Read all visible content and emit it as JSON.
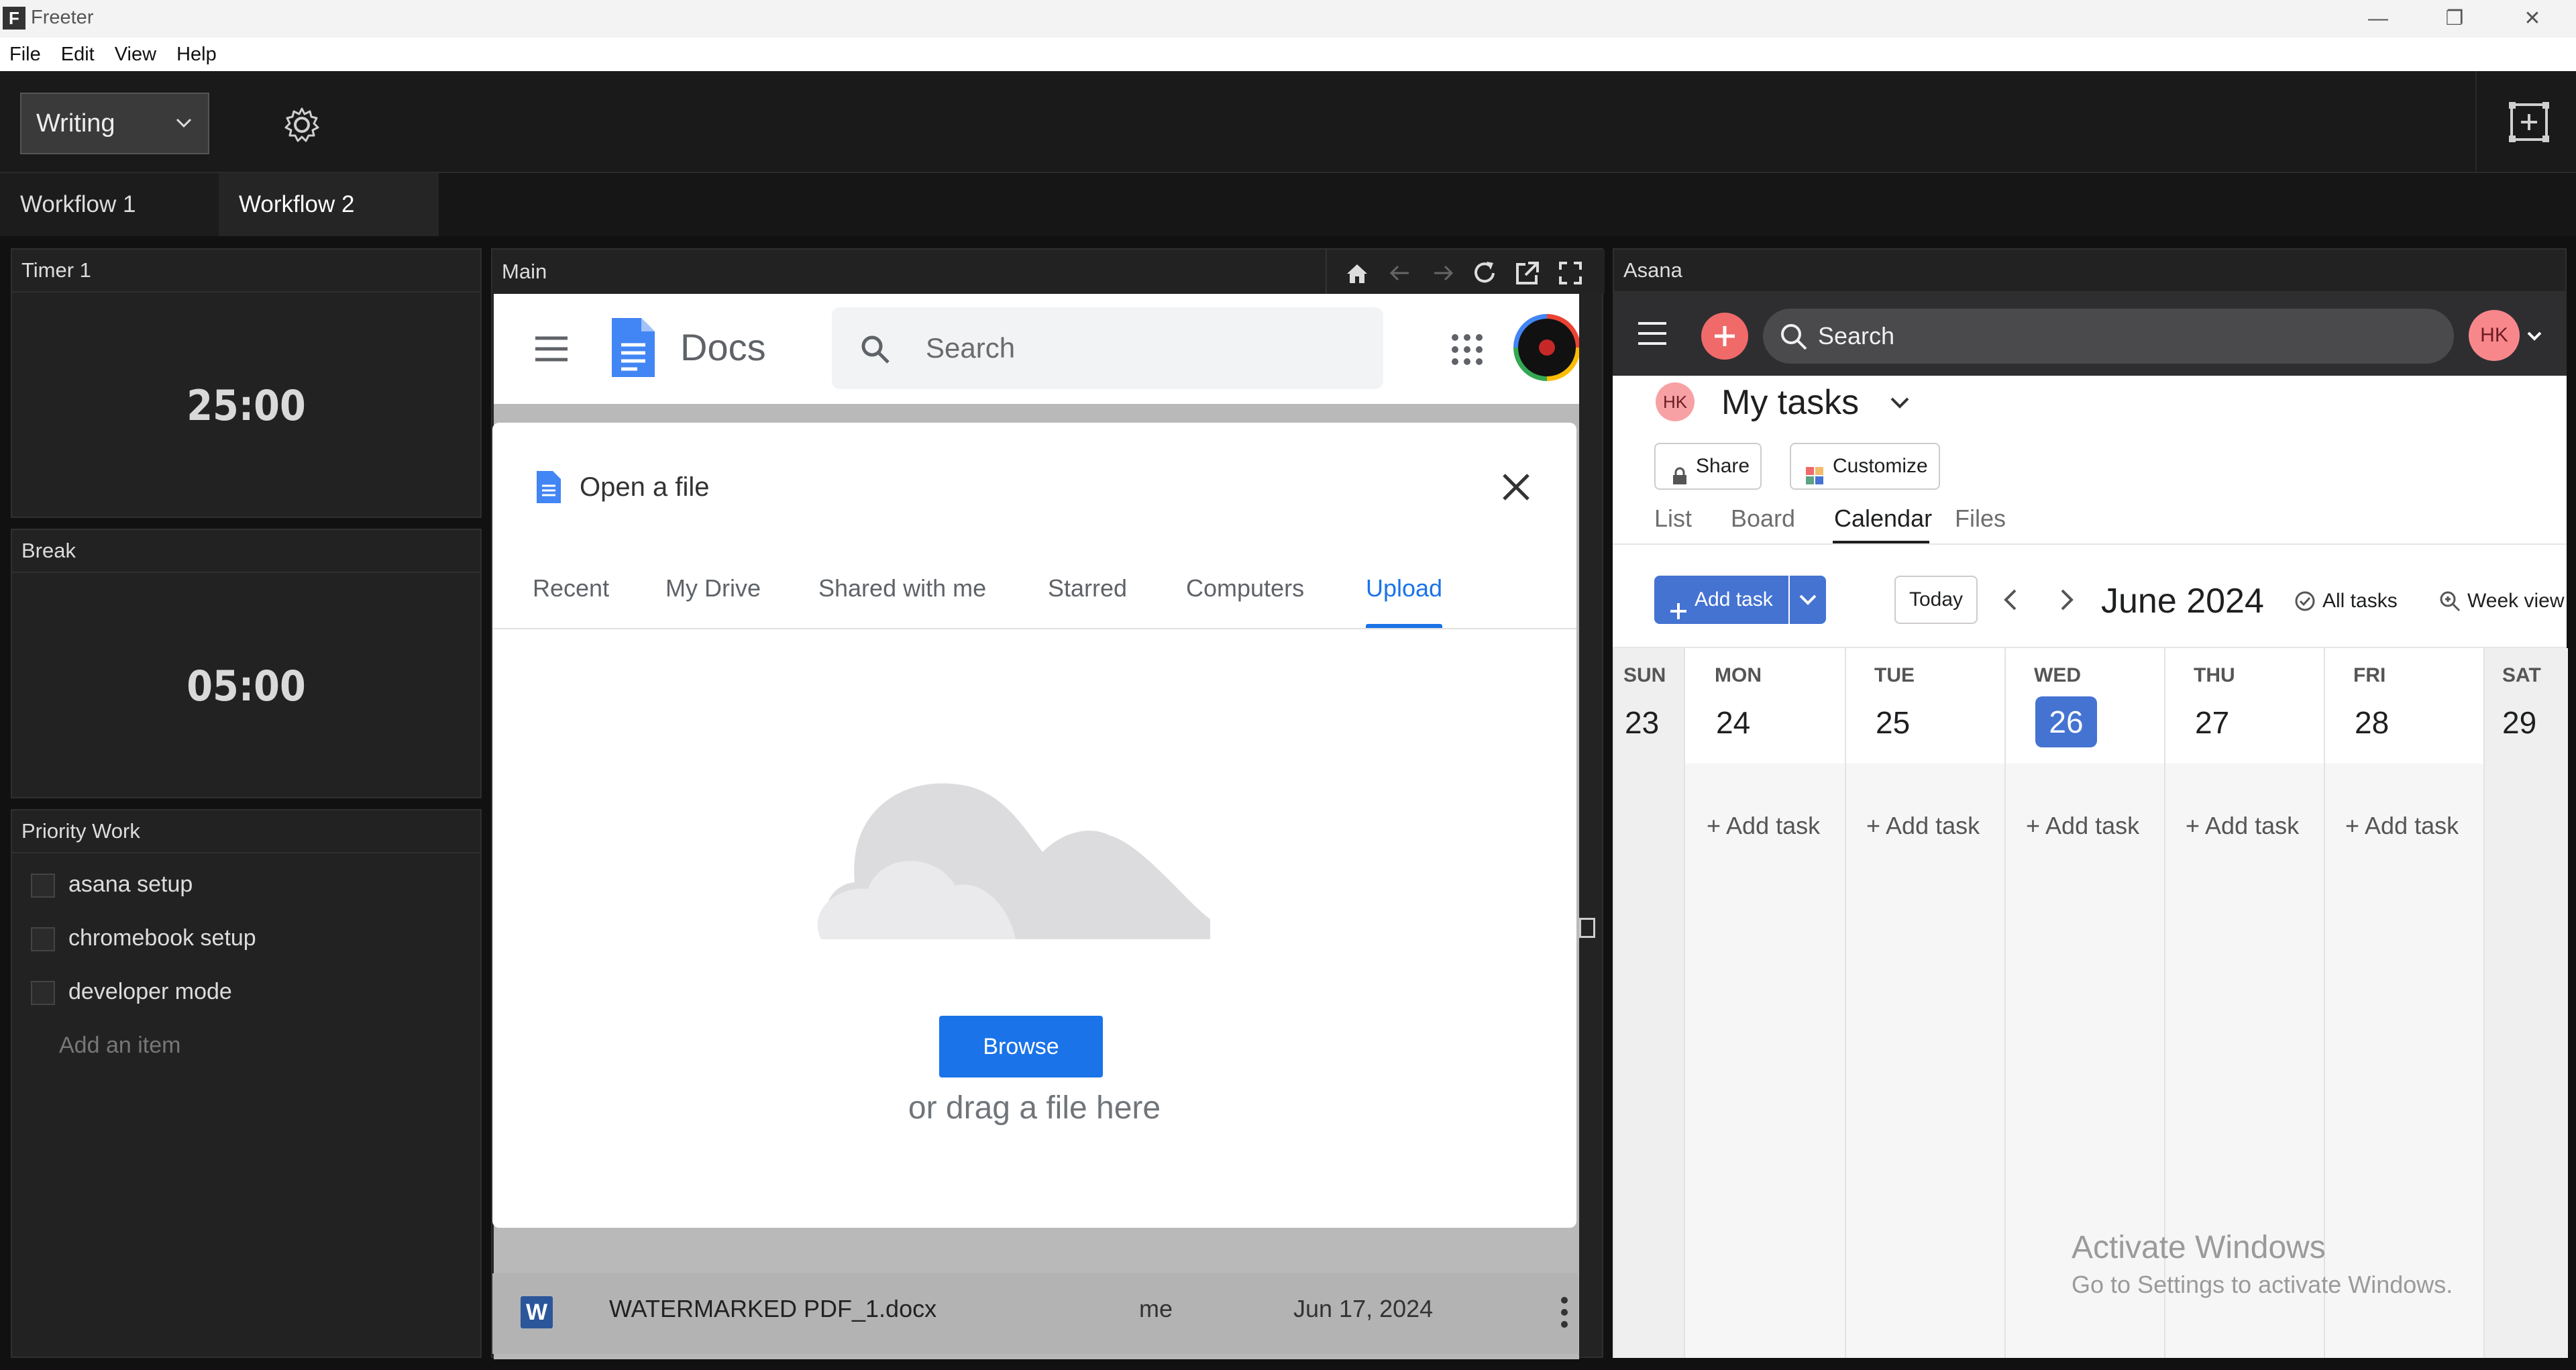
{
  "window": {
    "title": "Freeter",
    "logo": "F"
  },
  "menu": [
    "File",
    "Edit",
    "View",
    "Help"
  ],
  "toolbar": {
    "workspace": "Writing"
  },
  "tabs": [
    "Workflow 1",
    "Workflow 2"
  ],
  "timers": [
    {
      "title": "Timer 1",
      "value": "25:00"
    },
    {
      "title": "Break",
      "value": "05:00"
    }
  ],
  "todo": {
    "title": "Priority Work",
    "items": [
      "asana setup",
      "chromebook setup",
      "developer mode"
    ],
    "placeholder": "Add an item"
  },
  "main": {
    "title": "Main",
    "docs": {
      "app_name": "Docs",
      "search_placeholder": "Search",
      "dialog": {
        "title": "Open a file",
        "tabs": [
          "Recent",
          "My Drive",
          "Shared with me",
          "Starred",
          "Computers",
          "Upload"
        ],
        "active_tab": "Upload",
        "browse_label": "Browse",
        "drag_text": "or drag a file here"
      },
      "file": {
        "name": "WATERMARKED PDF_1.docx",
        "owner": "me",
        "date": "Jun 17, 2024"
      }
    }
  },
  "asana": {
    "title": "Asana",
    "search_placeholder": "Search",
    "avatar": "HK",
    "page_title": "My tasks",
    "share_label": "Share",
    "customize_label": "Customize",
    "views": [
      "List",
      "Board",
      "Calendar",
      "Files"
    ],
    "active_view": "Calendar",
    "add_task_label": "Add task",
    "today_label": "Today",
    "month": "June 2024",
    "all_tasks_label": "All tasks",
    "week_view_label": "Week view",
    "days": [
      {
        "name": "SUN",
        "num": "23"
      },
      {
        "name": "MON",
        "num": "24"
      },
      {
        "name": "TUE",
        "num": "25"
      },
      {
        "name": "WED",
        "num": "26"
      },
      {
        "name": "THU",
        "num": "27"
      },
      {
        "name": "FRI",
        "num": "28"
      },
      {
        "name": "SAT",
        "num": "29"
      }
    ],
    "add_task_cell": "Add task",
    "accent": "#4573d2"
  },
  "watermark": {
    "line1": "Activate Windows",
    "line2": "Go to Settings to activate Windows."
  }
}
